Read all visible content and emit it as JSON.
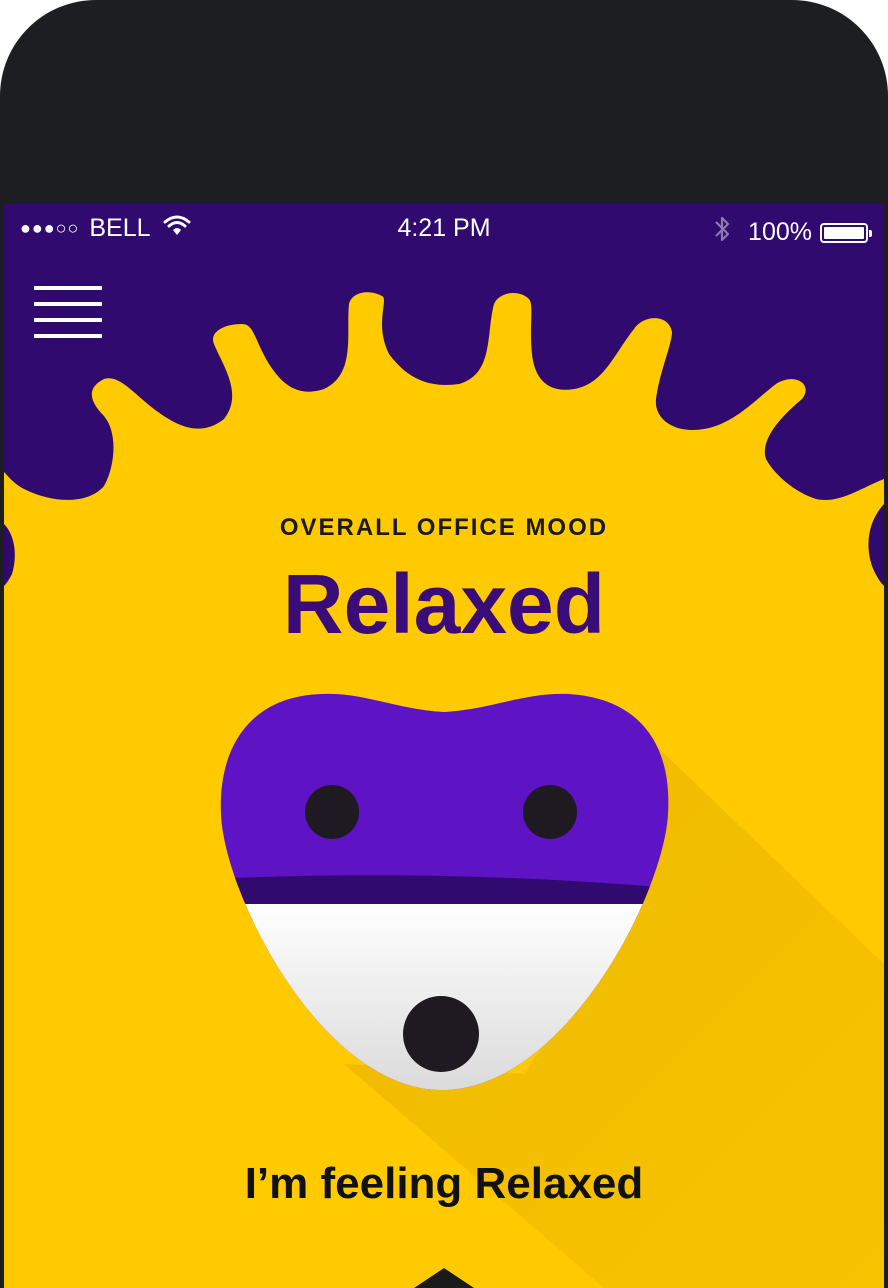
{
  "status_bar": {
    "signal": "●●●○○",
    "carrier": "BELL",
    "time": "4:21 PM",
    "battery": "100%"
  },
  "mood": {
    "label": "OVERALL OFFICE MOOD",
    "title": "Relaxed"
  },
  "action": {
    "feeling": "I’m feeling Relaxed"
  },
  "colors": {
    "background": "#ffcb00",
    "splash": "#300a6e",
    "face": "#5e13c4",
    "title": "#3a0c7a",
    "device": "#1d1e21"
  },
  "icons": [
    "wifi-icon",
    "bluetooth-icon",
    "battery-icon",
    "menu-icon",
    "chevron-up-icon"
  ]
}
